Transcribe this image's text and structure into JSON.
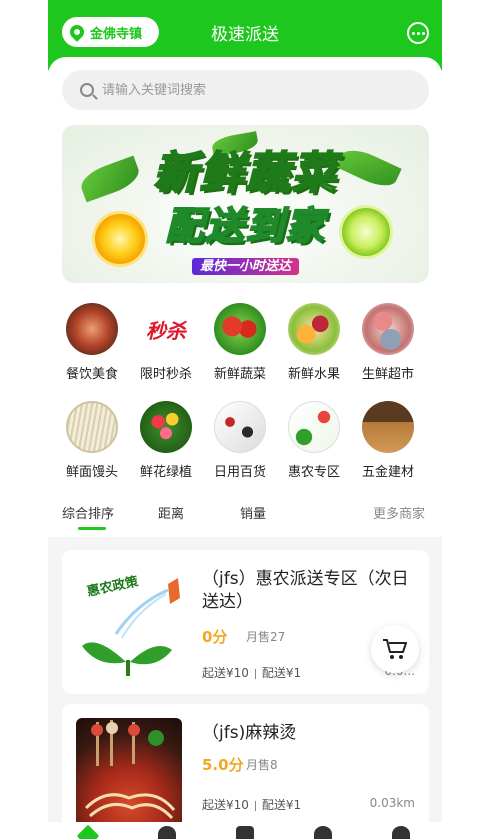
{
  "header": {
    "location": "金佛寺镇",
    "title": "极速派送"
  },
  "search": {
    "placeholder": "请输入关键词搜索"
  },
  "banner": {
    "line1": "新鲜蔬菜",
    "line2": "配送到家",
    "tagline": "最快一小时送达"
  },
  "categories": [
    {
      "label": "餐饮美食",
      "icon": "food-dish-icon"
    },
    {
      "label": "限时秒杀",
      "icon": "flash-sale-icon"
    },
    {
      "label": "新鲜蔬菜",
      "icon": "vegetables-icon"
    },
    {
      "label": "新鲜水果",
      "icon": "fruits-icon"
    },
    {
      "label": "生鲜超市",
      "icon": "fresh-meat-icon"
    },
    {
      "label": "鲜面馒头",
      "icon": "noodles-icon"
    },
    {
      "label": "鲜花绿植",
      "icon": "flowers-icon"
    },
    {
      "label": "日用百货",
      "icon": "daily-goods-icon"
    },
    {
      "label": "惠农专区",
      "icon": "agriculture-icon"
    },
    {
      "label": "五金建材",
      "icon": "hardware-icon"
    }
  ],
  "sort_tabs": {
    "overall": "综合排序",
    "distance": "距离",
    "sales": "销量",
    "more": "更多商家"
  },
  "stores": [
    {
      "name": "（jfs）惠农派送专区（次日送达）",
      "score": "0分",
      "sales": "月售27",
      "min_order": "起送¥10",
      "delivery_fee": "配送¥1",
      "distance": "0.0..."
    },
    {
      "name": "（jfs)麻辣烫",
      "score": "5.0分",
      "sales": "月售8",
      "min_order": "起送¥10",
      "delivery_fee": "配送¥1",
      "distance": "0.03km"
    }
  ],
  "colors": {
    "brand": "#1ec71e",
    "score": "#f5a623"
  }
}
